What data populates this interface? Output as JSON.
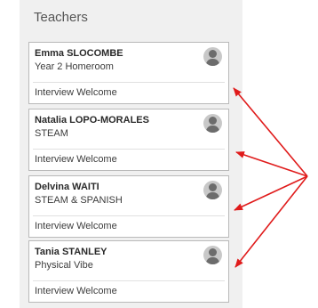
{
  "section_title": "Teachers",
  "teachers": [
    {
      "name": "Emma SLOCOMBE",
      "subject": "Year 2 Homeroom",
      "action": "Interview Welcome"
    },
    {
      "name": "Natalia LOPO-MORALES",
      "subject": "STEAM",
      "action": "Interview Welcome"
    },
    {
      "name": "Delvina WAITI",
      "subject": "STEAM & SPANISH",
      "action": "Interview Welcome"
    },
    {
      "name": "Tania STANLEY",
      "subject": "Physical Vibe",
      "action": "Interview Welcome"
    }
  ],
  "colors": {
    "annotation_arrow": "#e01b1b",
    "panel_background": "#f0f0f0"
  },
  "icons": {
    "avatar": "person-avatar-icon"
  }
}
